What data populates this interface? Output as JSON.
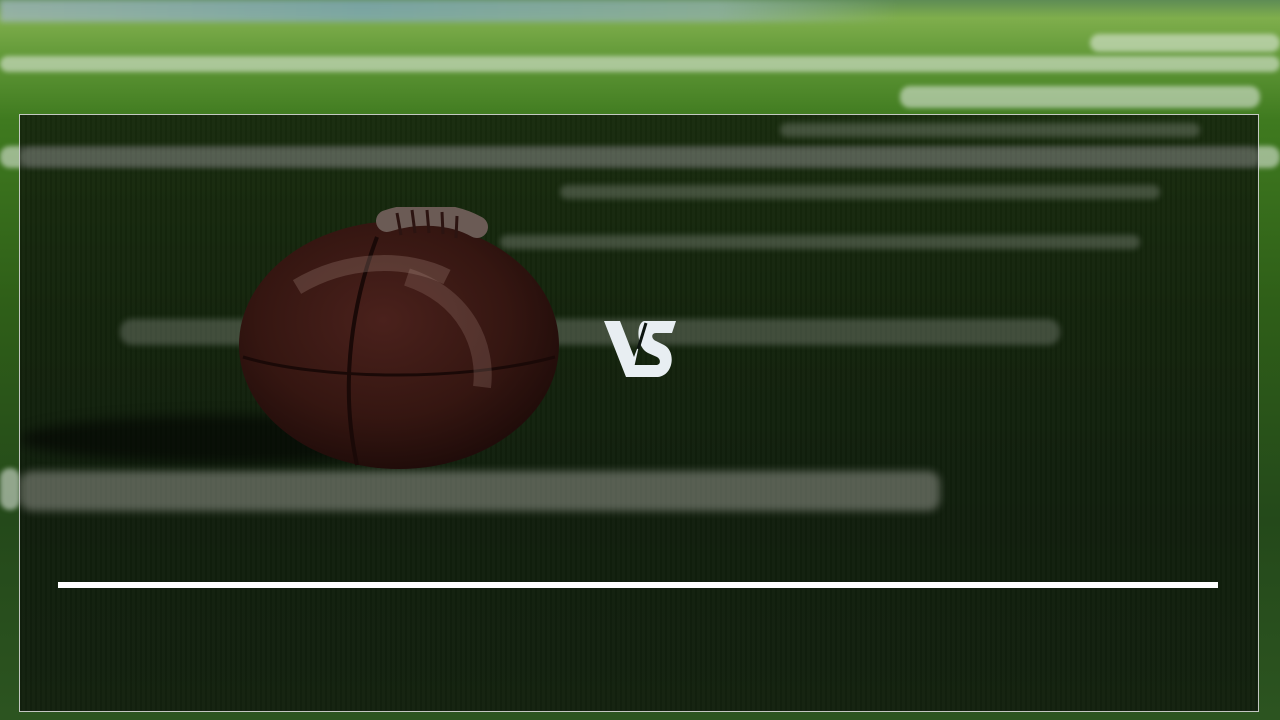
{
  "slide": {
    "vs_text": "VS",
    "vs_color": "#e8eef2",
    "divider_color": "#ffffff",
    "background_image": "football-field-icon",
    "overlay_color": "#0a0e08"
  }
}
